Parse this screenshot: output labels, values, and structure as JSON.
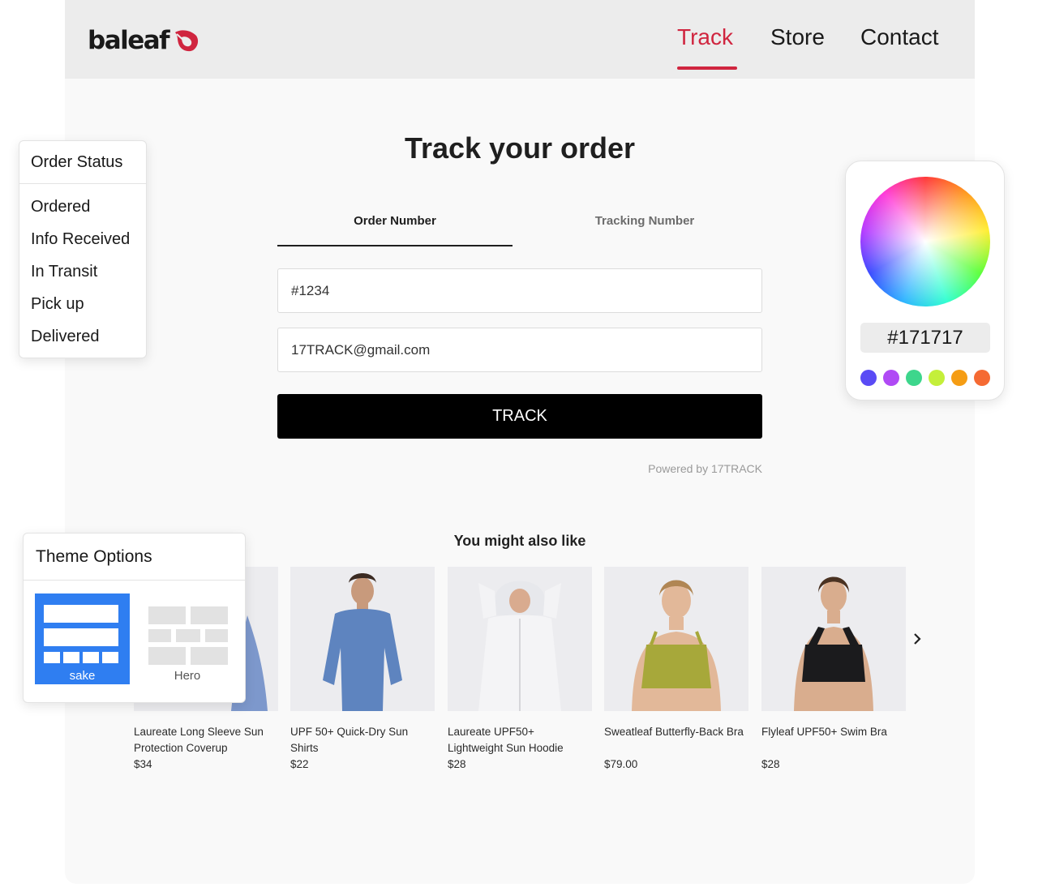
{
  "header": {
    "logo_text": "baleaf",
    "nav": [
      {
        "label": "Track",
        "active": true
      },
      {
        "label": "Store",
        "active": false
      },
      {
        "label": "Contact",
        "active": false
      }
    ],
    "accent_color": "#d0253f"
  },
  "main": {
    "title": "Track your order",
    "tabs": [
      {
        "label": "Order Number",
        "active": true
      },
      {
        "label": "Tracking Number",
        "active": false
      }
    ],
    "order_number_value": "#1234",
    "email_value": "17TRACK@gmail.com",
    "track_button": "TRACK",
    "powered_by": "Powered by 17TRACK"
  },
  "recommendations": {
    "heading": "You might also like",
    "products": [
      {
        "name": "Laureate Long Sleeve Sun Protection Coverup",
        "price": "$34",
        "image": "long-sleeve-coverup"
      },
      {
        "name": "UPF 50+ Quick-Dry Sun Shirts",
        "price": "$22",
        "image": "blue-sun-shirt"
      },
      {
        "name": "Laureate UPF50+ Lightweight Sun Hoodie",
        "price": "$28",
        "image": "white-sun-hoodie"
      },
      {
        "name": "Sweatleaf Butterfly-Back Bra",
        "price": "$79.00",
        "image": "olive-sports-bra"
      },
      {
        "name": "Flyleaf UPF50+ Swim Bra",
        "price": "$28",
        "image": "black-swim-bra"
      }
    ],
    "next_icon": "chevron-right-icon"
  },
  "order_status_panel": {
    "title": "Order Status",
    "items": [
      "Ordered",
      "Info Received",
      "In Transit",
      "Pick up",
      "Delivered"
    ]
  },
  "color_panel": {
    "hex": "#171717",
    "swatches": [
      "#5a4bf5",
      "#b04af5",
      "#3dd68c",
      "#c4ef3a",
      "#f59d14",
      "#f56a33"
    ]
  },
  "theme_panel": {
    "title": "Theme Options",
    "options": [
      {
        "label": "sake",
        "selected": true,
        "color": "#2f7ef1"
      },
      {
        "label": "Hero",
        "selected": false
      }
    ]
  }
}
